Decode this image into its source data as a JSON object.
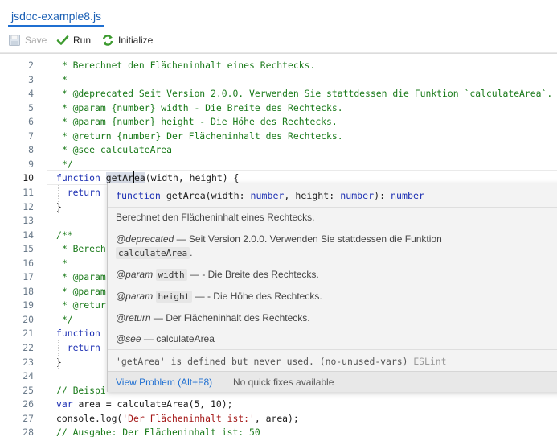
{
  "tab": {
    "title": "jsdoc-example8.js"
  },
  "toolbar": {
    "save": "Save",
    "run": "Run",
    "initialize": "Initialize"
  },
  "lines": [
    {
      "n": "2",
      "p": [
        {
          "t": " * Berechnet den Flächeninhalt eines Rechtecks.",
          "c": "c-com"
        }
      ]
    },
    {
      "n": "3",
      "p": [
        {
          "t": " *",
          "c": "c-com"
        }
      ]
    },
    {
      "n": "4",
      "p": [
        {
          "t": " * @deprecated Seit Version 2.0.0. Verwenden Sie stattdessen die Funktion `calculateArea`.",
          "c": "c-com"
        }
      ]
    },
    {
      "n": "5",
      "p": [
        {
          "t": " * @param {number} width - Die Breite des Rechtecks.",
          "c": "c-com"
        }
      ]
    },
    {
      "n": "6",
      "p": [
        {
          "t": " * @param {number} height - Die Höhe des Rechtecks.",
          "c": "c-com"
        }
      ]
    },
    {
      "n": "7",
      "p": [
        {
          "t": " * @return {number} Der Flächeninhalt des Rechtecks.",
          "c": "c-com"
        }
      ]
    },
    {
      "n": "8",
      "p": [
        {
          "t": " * @see calculateArea",
          "c": "c-com"
        }
      ]
    },
    {
      "n": "9",
      "p": [
        {
          "t": " */",
          "c": "c-com"
        }
      ]
    },
    {
      "n": "10",
      "active": true,
      "p": [
        {
          "t": "function ",
          "c": "c-kw"
        },
        {
          "t": "getAr",
          "c": "c-txt hl-word"
        },
        {
          "caret": true
        },
        {
          "t": "ea",
          "c": "c-txt hl-word"
        },
        {
          "t": "(width, height) {",
          "c": "c-txt"
        }
      ]
    },
    {
      "n": "11",
      "p": [
        {
          "t": "  ",
          "c": "c-txt"
        },
        {
          "t": "return",
          "c": "c-kw"
        }
      ]
    },
    {
      "n": "12",
      "p": [
        {
          "t": "}",
          "c": "c-txt"
        }
      ]
    },
    {
      "n": "13",
      "p": []
    },
    {
      "n": "14",
      "p": [
        {
          "t": "/**",
          "c": "c-com"
        }
      ]
    },
    {
      "n": "15",
      "p": [
        {
          "t": " * Berech",
          "c": "c-com"
        }
      ]
    },
    {
      "n": "16",
      "p": [
        {
          "t": " *",
          "c": "c-com"
        }
      ]
    },
    {
      "n": "17",
      "p": [
        {
          "t": " * @param",
          "c": "c-com"
        }
      ]
    },
    {
      "n": "18",
      "p": [
        {
          "t": " * @param",
          "c": "c-com"
        }
      ]
    },
    {
      "n": "19",
      "p": [
        {
          "t": " * @retur",
          "c": "c-com"
        }
      ]
    },
    {
      "n": "20",
      "p": [
        {
          "t": " */",
          "c": "c-com"
        }
      ]
    },
    {
      "n": "21",
      "p": [
        {
          "t": "function",
          "c": "c-kw"
        }
      ]
    },
    {
      "n": "22",
      "p": [
        {
          "t": "  ",
          "c": "c-txt"
        },
        {
          "t": "return",
          "c": "c-kw"
        }
      ]
    },
    {
      "n": "23",
      "p": [
        {
          "t": "}",
          "c": "c-txt"
        }
      ]
    },
    {
      "n": "24",
      "p": []
    },
    {
      "n": "25",
      "p": [
        {
          "t": "// Beispi",
          "c": "c-com"
        }
      ]
    },
    {
      "n": "26",
      "p": [
        {
          "t": "var ",
          "c": "c-kw"
        },
        {
          "t": "area = calculateArea(5, 10);",
          "c": "c-txt"
        }
      ]
    },
    {
      "n": "27",
      "p": [
        {
          "t": "console.log(",
          "c": "c-txt"
        },
        {
          "t": "'Der Flächeninhalt ist:'",
          "c": "c-str"
        },
        {
          "t": ", area);",
          "c": "c-txt"
        }
      ]
    },
    {
      "n": "28",
      "p": [
        {
          "t": "// Ausgabe: Der Flächeninhalt ist: 50",
          "c": "c-com"
        }
      ]
    }
  ],
  "hover": {
    "sig_kw": "function",
    "sig_name": " getArea(width: ",
    "sig_t1": "number",
    "sig_mid": ", height: ",
    "sig_t2": "number",
    "sig_end": "): ",
    "sig_t3": "number",
    "description": "Berechnet den Flächeninhalt eines Rechtecks.",
    "deprecated_tag": "@deprecated",
    "deprecated_text": " — Seit Version 2.0.0. Verwenden Sie stattdessen die Funktion",
    "deprecated_code": "calculateArea",
    "deprecated_end": ".",
    "param1_tag": "@param",
    "param1_name": "width",
    "param1_text": " — - Die Breite des Rechtecks.",
    "param2_tag": "@param",
    "param2_name": "height",
    "param2_text": " — - Die Höhe des Rechtecks.",
    "return_tag": "@return",
    "return_text": " — Der Flächeninhalt des Rechtecks.",
    "see_tag": "@see",
    "see_text": " — calculateArea",
    "diag_msg": "'getArea' is defined but never used. (no-unused-vars) ",
    "diag_src": "ESLint",
    "view_problem": "View Problem (Alt+F8)",
    "no_fixes": "No quick fixes available"
  }
}
